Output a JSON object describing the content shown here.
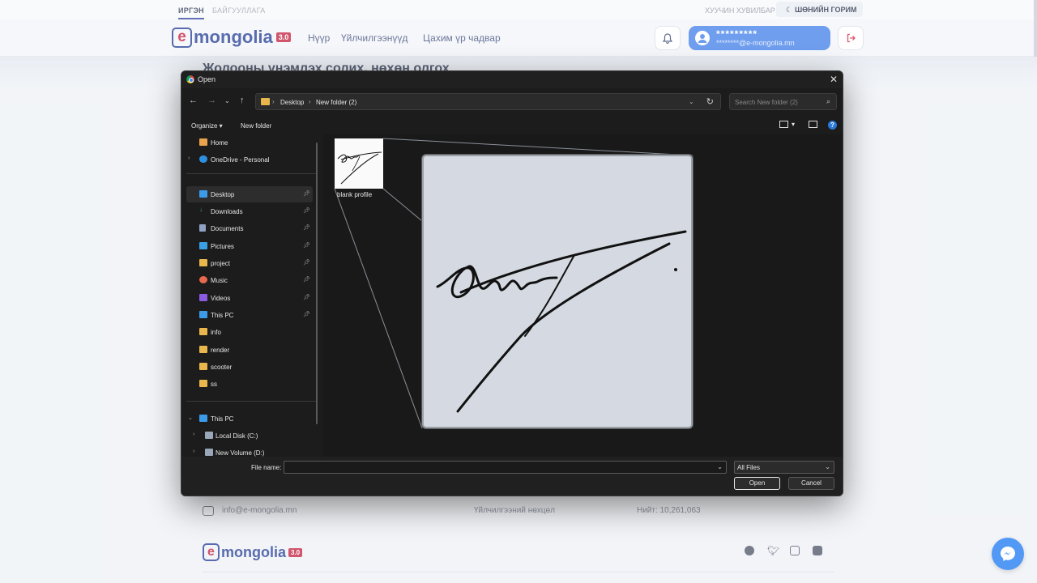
{
  "topbar": {
    "tab_citizen": "ИРГЭН",
    "tab_org": "БАЙГУУЛЛАГА",
    "personal": "ХУУЧИН ХУВИЛБАР",
    "night_mode": "ШӨНИЙН ГОРИМ"
  },
  "header": {
    "logo_letter": "e",
    "logo_word": "mongolia",
    "logo_version": "3.0",
    "nav": [
      "Нүүр",
      "Үйлчилгээнүүд",
      "Цахим үр чадвар"
    ],
    "user_name": "*********",
    "user_email": "********@e-mongolia.mn"
  },
  "page": {
    "title": "Жолооны үнэмлэх солих, нөхөн олгох"
  },
  "footer": {
    "email": "info@e-mongolia.mn",
    "terms": "Үйлчилгээний нөхцөл",
    "total": "Нийт: 10,261,063"
  },
  "dialog": {
    "title": "Open",
    "breadcrumb": [
      "Desktop",
      "New folder (2)"
    ],
    "search_placeholder": "Search New folder (2)",
    "organize": "Organize ▾",
    "new_folder": "New folder",
    "nav_items": [
      {
        "label": "Home",
        "color": "#e8a34c"
      },
      {
        "label": "OneDrive - Personal",
        "color": "#2f8fe0"
      },
      {
        "label": "Desktop",
        "color": "#3c9be8"
      },
      {
        "label": "Downloads",
        "color": "#3fa86a"
      },
      {
        "label": "Documents",
        "color": "#8fa2c4"
      },
      {
        "label": "Pictures",
        "color": "#3aa0e4"
      },
      {
        "label": "project",
        "color": "#e8b64c"
      },
      {
        "label": "Music",
        "color": "#e86a4c"
      },
      {
        "label": "Videos",
        "color": "#8a5ae0"
      },
      {
        "label": "This PC",
        "color": "#3c9be8"
      },
      {
        "label": "info",
        "color": "#e8b64c"
      },
      {
        "label": "render",
        "color": "#e8b64c"
      },
      {
        "label": "scooter",
        "color": "#e8b64c"
      },
      {
        "label": "ss",
        "color": "#e8b64c"
      },
      {
        "label": "This PC",
        "color": "#3c9be8"
      },
      {
        "label": "Local Disk (C:)",
        "color": "#9aa7b8"
      },
      {
        "label": "New Volume (D:)",
        "color": "#9aa7b8"
      }
    ],
    "file_name": "blank profile",
    "file_name_label": "File name:",
    "file_name_value": "",
    "filter": "All Files",
    "open_button": "Open",
    "cancel_button": "Cancel"
  }
}
